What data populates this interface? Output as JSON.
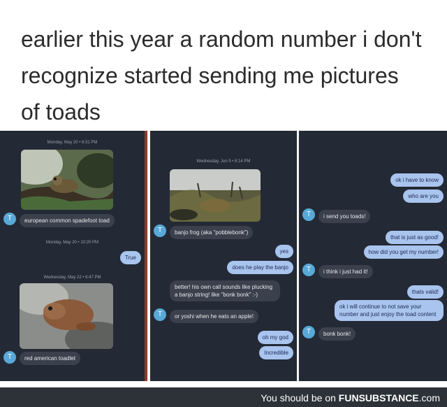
{
  "caption": {
    "line1": "earlier this year a random number i don't",
    "line2": "recognize started sending me pictures",
    "line3": "of toads"
  },
  "panel1": {
    "timestamp1": "Monday, May 20 • 6:31 PM",
    "msg1": "european common spadefoot toad",
    "timestamp2": "Monday, May 20 • 10:20 PM",
    "reply1": "True",
    "timestamp3": "Wednesday, May 22 • 6:47 PM",
    "msg2": "red american toadlet",
    "avatar": "T"
  },
  "panel2": {
    "timestamp1": "Wednesday, Jun 5 • 8:14 PM",
    "msg1": "banjo frog (aka \"pobblebonk\")",
    "reply1": "yes",
    "reply2": "does he play the banjo",
    "msg2": "better! his own call sounds like plucking a banjo string! like \"bonk bonk\" :-)",
    "msg3": "or yoshi when he eats an apple!",
    "reply3": "oh my god",
    "reply4": "Incredible",
    "avatar": "T"
  },
  "panel3": {
    "reply1": "ok i have to know",
    "reply2": "who are you",
    "msg1": "i send you toads!",
    "reply3": "that is just as good!",
    "reply4": "how did you get my number!",
    "msg2": "i think i just had it!",
    "reply5": "thats valid!",
    "reply6": "ok i will continue to not save your number and just enjoy the toad content",
    "msg3": "bonk bonk!",
    "avatar": "T"
  },
  "footer": {
    "prefix": "You should be on ",
    "brand": "FUNSUBSTANCE",
    "suffix": ".com"
  },
  "colors": {
    "chat_bg": "#232a35",
    "incoming_bubble": "#3a404c",
    "outgoing_bubble": "#a9c4ee",
    "avatar": "#58a9d8",
    "footer_bg": "#2d3238"
  }
}
